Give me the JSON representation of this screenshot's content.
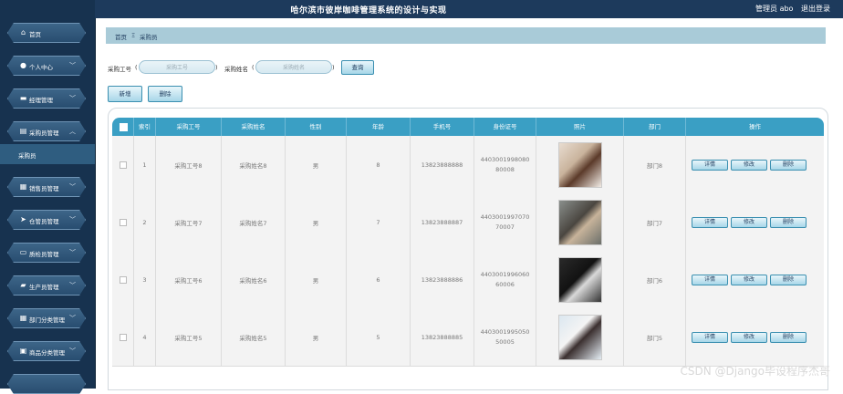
{
  "header": {
    "title": "哈尔滨市彼岸咖啡管理系统的设计与实现",
    "user_label": "管理员 abo",
    "logout": "退出登录"
  },
  "sidebar": {
    "items": [
      {
        "label": "首页",
        "icon": "home-icon"
      },
      {
        "label": "个人中心",
        "icon": "user-icon"
      },
      {
        "label": "经理管理",
        "icon": "message-icon"
      },
      {
        "label": "采购员管理",
        "icon": "list-icon"
      },
      {
        "label": "销售员管理",
        "icon": "grid-icon"
      },
      {
        "label": "仓管员管理",
        "icon": "send-icon"
      },
      {
        "label": "质检员管理",
        "icon": "monitor-icon"
      },
      {
        "label": "生产员管理",
        "icon": "ticket-icon"
      },
      {
        "label": "部门分类管理",
        "icon": "grid-icon"
      },
      {
        "label": "商品分类管理",
        "icon": "doc-icon"
      }
    ],
    "active_sub": "采购员"
  },
  "breadcrumb": {
    "home": "首页",
    "sep": "Ξ",
    "current": "采购员"
  },
  "search": {
    "no_label": "采购工号",
    "no_placeholder": "采购工号",
    "name_label": "采购姓名",
    "name_placeholder": "采购姓名",
    "query": "查询"
  },
  "actions": {
    "add": "新增",
    "delete": "删除"
  },
  "table": {
    "headers": [
      "索引",
      "采购工号",
      "采购姓名",
      "性别",
      "年龄",
      "手机号",
      "身份证号",
      "照片",
      "部门",
      "操作"
    ],
    "op_labels": {
      "detail": "详情",
      "edit": "修改",
      "remove": "删除"
    },
    "rows": [
      {
        "idx": "1",
        "no": "采购工号8",
        "name": "采购姓名8",
        "sex": "男",
        "age": "8",
        "phone": "13823888888",
        "idcard": "440300199808080008",
        "dept": "部门8"
      },
      {
        "idx": "2",
        "no": "采购工号7",
        "name": "采购姓名7",
        "sex": "男",
        "age": "7",
        "phone": "13823888887",
        "idcard": "440300199707070007",
        "dept": "部门7"
      },
      {
        "idx": "3",
        "no": "采购工号6",
        "name": "采购姓名6",
        "sex": "男",
        "age": "6",
        "phone": "13823888886",
        "idcard": "440300199606060006",
        "dept": "部门6"
      },
      {
        "idx": "4",
        "no": "采购工号5",
        "name": "采购姓名5",
        "sex": "男",
        "age": "5",
        "phone": "13823888885",
        "idcard": "440300199505050005",
        "dept": "部门5"
      }
    ]
  },
  "watermark": "CSDN @Django毕设程序杰哥"
}
